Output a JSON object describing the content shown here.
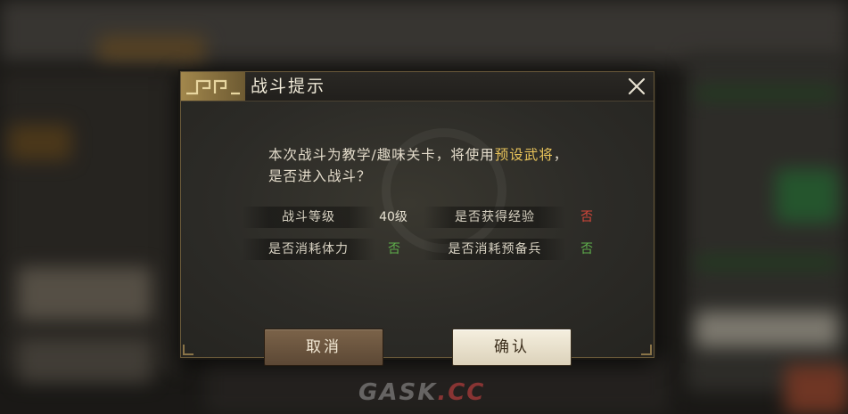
{
  "dialog": {
    "title": "战斗提示",
    "message_prefix": "本次战斗为教学/趣味关卡，将使用",
    "message_highlight": "预设武将",
    "message_suffix": "，是否进入战斗？",
    "rows": [
      {
        "left_label": "战斗等级",
        "left_value": "40级",
        "right_label": "是否获得经验",
        "right_value": "否"
      },
      {
        "left_label": "是否消耗体力",
        "left_value": "否",
        "right_label": "是否消耗预备兵",
        "right_value": "否"
      }
    ],
    "cancel_label": "取消",
    "confirm_label": "确认",
    "colors": {
      "highlight": "#e8c35a",
      "no_red": "#d6473a",
      "no_green": "#5fb04c"
    }
  },
  "watermark": {
    "text_a": "GASK",
    "text_b": ".CC"
  },
  "icons": [
    "close-icon",
    "title-ornament-icon"
  ]
}
